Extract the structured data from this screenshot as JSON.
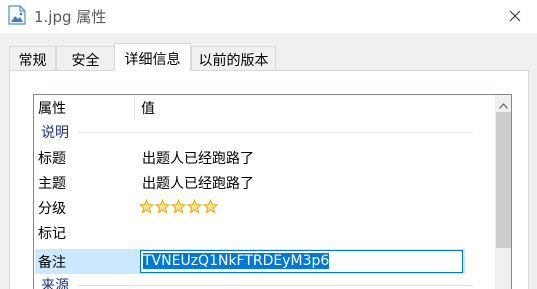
{
  "window": {
    "title": "1.jpg 属性",
    "icon": "image-file-icon",
    "close_icon": "close-icon"
  },
  "tabs": [
    {
      "label": "常规",
      "active": false
    },
    {
      "label": "安全",
      "active": false
    },
    {
      "label": "详细信息",
      "active": true
    },
    {
      "label": "以前的版本",
      "active": false
    }
  ],
  "details": {
    "columns": {
      "property": "属性",
      "value": "值"
    },
    "groups": [
      {
        "name": "说明",
        "rows": [
          {
            "name": "标题",
            "value": "出题人已经跑路了"
          },
          {
            "name": "主题",
            "value": "出题人已经跑路了"
          },
          {
            "name": "分级",
            "rating": 5,
            "rating_max": 5,
            "star_color": "#f5c518"
          },
          {
            "name": "标记",
            "value": ""
          },
          {
            "name": "备注",
            "value": "TVNEUzQ1NkFTRDEyM3p6",
            "editing": true,
            "selected": true
          }
        ]
      },
      {
        "name": "来源",
        "rows": []
      }
    ]
  },
  "scrollbar": {
    "up_icon": "scroll-up-arrow-icon",
    "down_icon": "scroll-down-arrow-icon"
  },
  "colors": {
    "accent": "#0078d7",
    "selection": "#cce8ff",
    "group_header": "#1e3287",
    "dialog_bg": "#f0f0f0"
  }
}
